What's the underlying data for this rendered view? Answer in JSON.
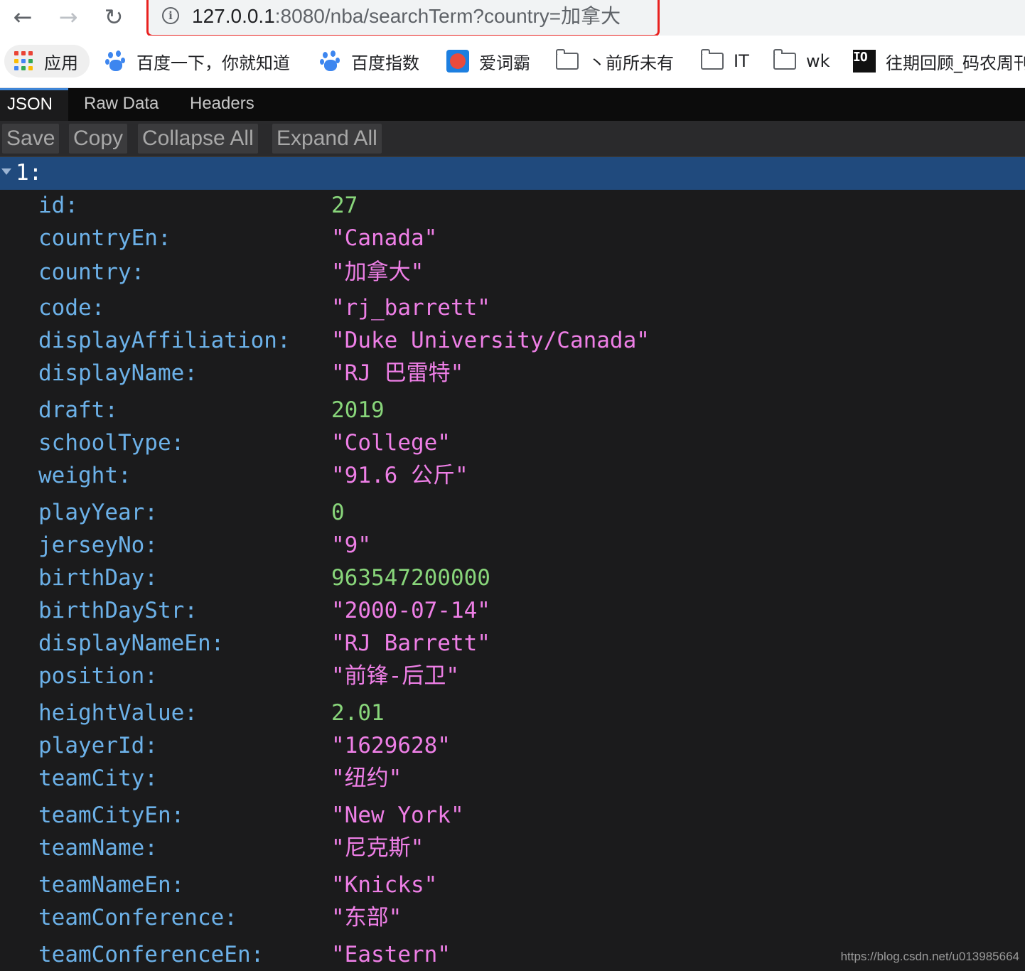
{
  "browser": {
    "url_host": "127.0.0.1",
    "url_rest": ":8080/nba/searchTerm?country=加拿大",
    "bookmarks": [
      {
        "label": "应用",
        "icon": "apps-grid-icon"
      },
      {
        "label": "百度一下，你就知道",
        "icon": "baidu-paw-icon"
      },
      {
        "label": "百度指数",
        "icon": "baidu-paw-icon"
      },
      {
        "label": "爱词霸",
        "icon": "iciba-icon"
      },
      {
        "label": "丶前所未有",
        "icon": "folder-icon"
      },
      {
        "label": "IT",
        "icon": "folder-icon"
      },
      {
        "label": "wk",
        "icon": "folder-icon"
      },
      {
        "label": "往期回顾_码农周刊",
        "icon": "io-logo-icon"
      }
    ]
  },
  "viewer": {
    "tabs": [
      "JSON",
      "Raw Data",
      "Headers"
    ],
    "actions": [
      "Save",
      "Copy",
      "Collapse All",
      "Expand All"
    ],
    "root_key": "1:",
    "entries": [
      {
        "key": "id:",
        "value": "27",
        "type": "num"
      },
      {
        "key": "countryEn:",
        "value": "\"Canada\"",
        "type": "str"
      },
      {
        "key": "country:",
        "value": "\"加拿大\"",
        "type": "str"
      },
      {
        "key": "code:",
        "value": "\"rj_barrett\"",
        "type": "str"
      },
      {
        "key": "displayAffiliation:",
        "value": "\"Duke University/Canada\"",
        "type": "str"
      },
      {
        "key": "displayName:",
        "value": "\"RJ 巴雷特\"",
        "type": "str"
      },
      {
        "key": "draft:",
        "value": "2019",
        "type": "num"
      },
      {
        "key": "schoolType:",
        "value": "\"College\"",
        "type": "str"
      },
      {
        "key": "weight:",
        "value": "\"91.6 公斤\"",
        "type": "str"
      },
      {
        "key": "playYear:",
        "value": "0",
        "type": "num"
      },
      {
        "key": "jerseyNo:",
        "value": "\"9\"",
        "type": "str"
      },
      {
        "key": "birthDay:",
        "value": "963547200000",
        "type": "num"
      },
      {
        "key": "birthDayStr:",
        "value": "\"2000-07-14\"",
        "type": "str"
      },
      {
        "key": "displayNameEn:",
        "value": "\"RJ Barrett\"",
        "type": "str"
      },
      {
        "key": "position:",
        "value": "\"前锋-后卫\"",
        "type": "str"
      },
      {
        "key": "heightValue:",
        "value": "2.01",
        "type": "num"
      },
      {
        "key": "playerId:",
        "value": "\"1629628\"",
        "type": "str"
      },
      {
        "key": "teamCity:",
        "value": "\"纽约\"",
        "type": "str"
      },
      {
        "key": "teamCityEn:",
        "value": "\"New York\"",
        "type": "str"
      },
      {
        "key": "teamName:",
        "value": "\"尼克斯\"",
        "type": "str"
      },
      {
        "key": "teamNameEn:",
        "value": "\"Knicks\"",
        "type": "str"
      },
      {
        "key": "teamConference:",
        "value": "\"东部\"",
        "type": "str"
      },
      {
        "key": "teamConferenceEn:",
        "value": "\"Eastern\"",
        "type": "str"
      }
    ]
  },
  "colors": {
    "key": "#6cb1e8",
    "string": "#ee7fe6",
    "number": "#88d57a",
    "selected_row": "#204a7d",
    "url_highlight": "#e8211f"
  },
  "watermark": "https://blog.csdn.net/u013985664"
}
